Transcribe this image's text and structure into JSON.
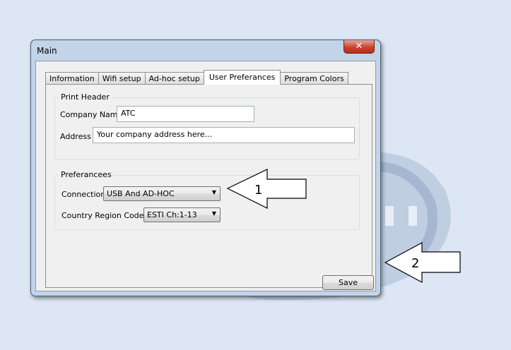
{
  "window": {
    "title": "Main",
    "close_label": "✕"
  },
  "tabs": [
    {
      "label": "Information"
    },
    {
      "label": "Wifi setup"
    },
    {
      "label": "Ad-hoc setup"
    },
    {
      "label": "User Preferances",
      "active": true
    },
    {
      "label": "Program Colors"
    }
  ],
  "print_header": {
    "title": "Print Header",
    "company_name_label": "Company Name",
    "company_name_value": "ATC",
    "address_label": "Address",
    "address_value": "Your company address here..."
  },
  "preferences": {
    "title": "Preferancees",
    "connection_label": "Connection",
    "connection_value": "USB And AD-HOC",
    "country_label": "Country Region Code",
    "country_value": "ESTI Ch:1-13"
  },
  "save_label": "Save",
  "callouts": [
    {
      "number": "1"
    },
    {
      "number": "2"
    }
  ],
  "icons": {
    "close": "close-icon",
    "dropdown": "chevron-down-icon"
  }
}
